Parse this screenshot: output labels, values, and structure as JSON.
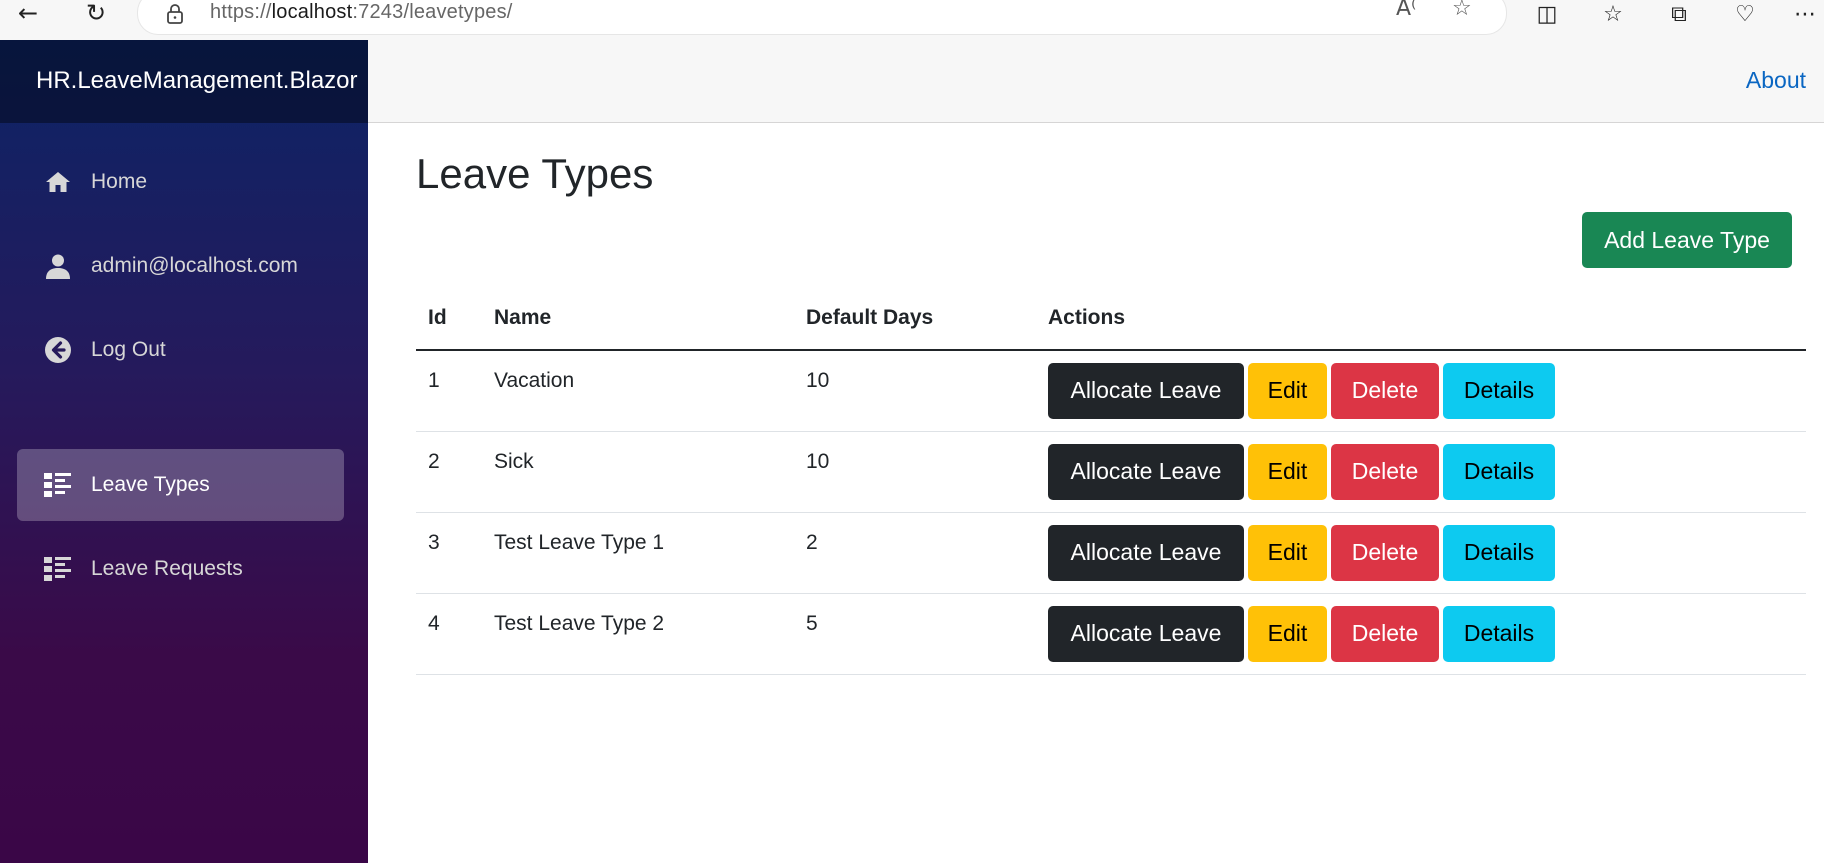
{
  "browser": {
    "url_prefix": "https://",
    "url_host": "localhost",
    "url_rest": ":7243/leavetypes/"
  },
  "sidebar": {
    "brand": "HR.LeaveManagement.Blazor",
    "items": [
      {
        "label": "Home",
        "icon": "home-icon"
      },
      {
        "label": "admin@localhost.com",
        "icon": "person-icon"
      },
      {
        "label": "Log Out",
        "icon": "arrow-left-circle-icon"
      },
      {
        "label": "Leave Types",
        "icon": "list-rich-icon",
        "active": true
      },
      {
        "label": "Leave Requests",
        "icon": "list-rich-icon"
      }
    ]
  },
  "topbar": {
    "about": "About"
  },
  "page": {
    "title": "Leave Types",
    "add_button": "Add Leave Type"
  },
  "table": {
    "headers": [
      "Id",
      "Name",
      "Default Days",
      "Actions"
    ],
    "rows": [
      {
        "id": "1",
        "name": "Vacation",
        "days": "10"
      },
      {
        "id": "2",
        "name": "Sick",
        "days": "10"
      },
      {
        "id": "3",
        "name": "Test Leave Type 1",
        "days": "2"
      },
      {
        "id": "4",
        "name": "Test Leave Type 2",
        "days": "5"
      }
    ],
    "actions": {
      "allocate": "Allocate Leave",
      "edit": "Edit",
      "delete": "Delete",
      "details": "Details"
    }
  },
  "colors": {
    "success": "#198754",
    "dark": "#212529",
    "warning": "#ffc107",
    "danger": "#dc3545",
    "info": "#0dcaf0",
    "link": "#0a66c2"
  }
}
